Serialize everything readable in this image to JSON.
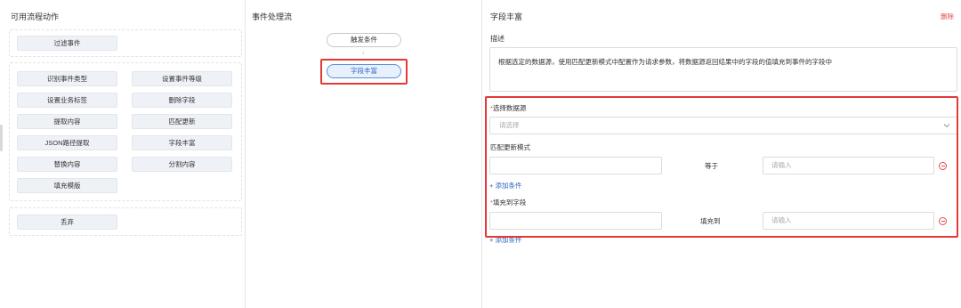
{
  "left_panel": {
    "title": "可用流程动作",
    "groups": [
      [
        "过滤事件"
      ],
      [
        "识别事件类型",
        "设置事件等级",
        "设置业务标签",
        "删除字段",
        "提取内容",
        "匹配更新",
        "JSON路径提取",
        "字段丰富",
        "替换内容",
        "分割内容",
        "填充模版"
      ],
      [
        "丢弃"
      ]
    ]
  },
  "mid_panel": {
    "title": "事件处理流",
    "nodes": [
      "触发条件",
      "字段丰富"
    ],
    "arrow": "↓"
  },
  "right_panel": {
    "title": "字段丰富",
    "delete_label": "删除",
    "description_label": "描述",
    "description_text": "根据选定的数据源，使用匹配更新模式中配置作为请求参数，将数据源返回结果中的字段的值填充到事件的字段中",
    "data_source": {
      "required_mark": "*",
      "label": "选择数据源",
      "placeholder": "请选择"
    },
    "match_mode": {
      "label": "匹配更新模式",
      "operator": "等于",
      "value_placeholder": "请输入",
      "add_label": "+ 添加条件"
    },
    "fill_field": {
      "required_mark": "*",
      "label": "填充到字段",
      "operator": "填充到",
      "value_placeholder": "请输入",
      "add_label": "+ 添加条件"
    }
  },
  "colors": {
    "accent": "#2f64c0",
    "danger": "#e5484d",
    "highlight": "#e53935",
    "chip_bg": "#eef1f6"
  }
}
